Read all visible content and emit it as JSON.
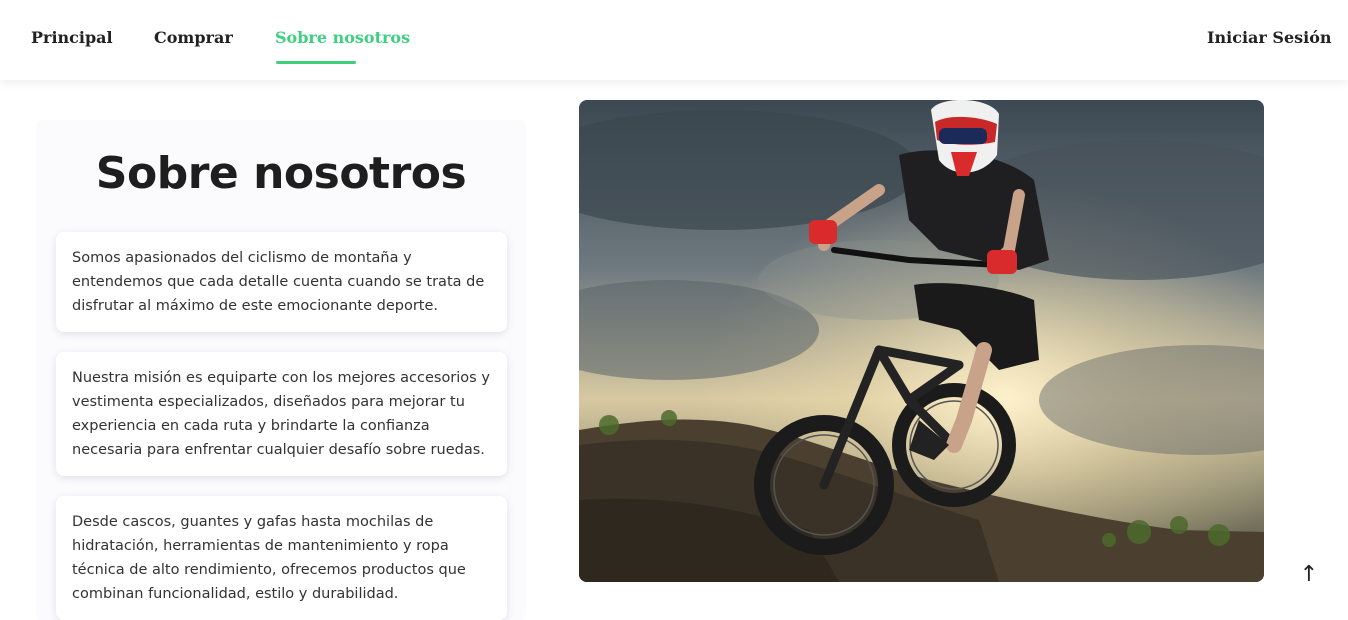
{
  "nav": {
    "items": [
      {
        "label": "Principal"
      },
      {
        "label": "Comprar"
      },
      {
        "label": "Sobre nosotros"
      }
    ],
    "login": "Iniciar Sesión",
    "accent": "#3ecf7f"
  },
  "about": {
    "title": "Sobre nosotros",
    "paragraphs": [
      "Somos apasionados del ciclismo de montaña y entendemos que cada detalle cuenta cuando se trata de disfrutar al máximo de este emocionante deporte.",
      "Nuestra misión es equiparte con los mejores accesorios y vestimenta especializados, diseñados para mejorar tu experiencia en cada ruta y brindarte la confianza necesaria para enfrentar cualquier desafío sobre ruedas.",
      "Desde cascos, guantes y gafas hasta mochilas de hidratación, herramientas de mantenimiento y ropa técnica de alto rendimiento, ofrecemos productos que combinan funcionalidad, estilo y durabilidad."
    ]
  },
  "scroll_top_icon": "↑"
}
